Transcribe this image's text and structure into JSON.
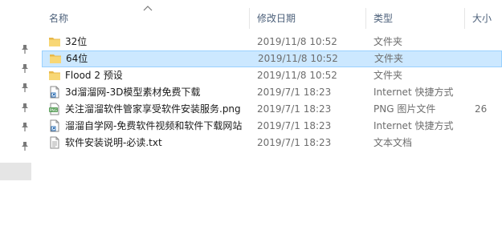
{
  "columns": {
    "name": "名称",
    "date": "修改日期",
    "type": "类型",
    "size": "大小"
  },
  "colors": {
    "selected_bg": "#cce8ff",
    "selected_border": "#99d1ff",
    "header_text": "#4c607a",
    "folder": "#f8d775"
  },
  "files": [
    {
      "icon": "folder-icon",
      "name": "32位",
      "date": "2019/11/8 10:52",
      "type": "文件夹",
      "size": "",
      "selected": false
    },
    {
      "icon": "folder-icon",
      "name": "64位",
      "date": "2019/11/8 10:52",
      "type": "文件夹",
      "size": "",
      "selected": true
    },
    {
      "icon": "folder-icon",
      "name": "Flood 2 预设",
      "date": "2019/11/8 10:52",
      "type": "文件夹",
      "size": "",
      "selected": false
    },
    {
      "icon": "internet-shortcut-icon",
      "name": "3d溜溜网-3D模型素材免费下载",
      "date": "2019/7/1 18:23",
      "type": "Internet 快捷方式",
      "size": "",
      "selected": false
    },
    {
      "icon": "png-file-icon",
      "name": "关注溜溜软件管家享受软件安装服务.png",
      "date": "2019/7/1 18:23",
      "type": "PNG 图片文件",
      "size": "26",
      "selected": false
    },
    {
      "icon": "internet-shortcut-icon",
      "name": "溜溜自学网-免费软件视频和软件下载网站",
      "date": "2019/7/1 18:23",
      "type": "Internet 快捷方式",
      "size": "",
      "selected": false
    },
    {
      "icon": "text-file-icon",
      "name": "软件安装说明-必读.txt",
      "date": "2019/7/1 18:23",
      "type": "文本文档",
      "size": "",
      "selected": false
    }
  ]
}
